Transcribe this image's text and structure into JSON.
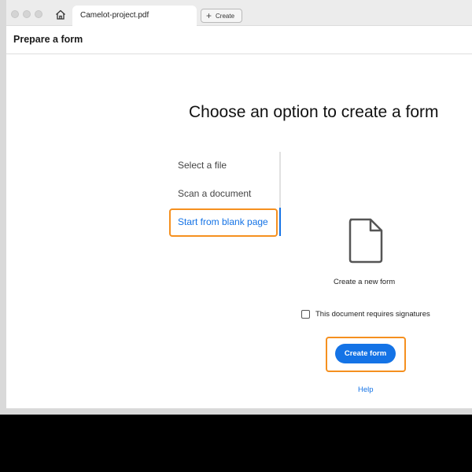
{
  "window": {
    "tab_title": "Camelot-project.pdf",
    "create_tab_label": "Create"
  },
  "toolbar": {
    "title": "Prepare a form"
  },
  "main": {
    "heading": "Choose an option to create a form",
    "options": [
      {
        "label": "Select a file",
        "selected": false
      },
      {
        "label": "Scan a document",
        "selected": false
      },
      {
        "label": "Start from blank page",
        "selected": true
      }
    ],
    "panel": {
      "icon": "document-icon",
      "label": "Create a new form",
      "checkbox_label": "This document requires signatures",
      "checkbox_checked": false,
      "create_button_label": "Create form",
      "help_label": "Help"
    }
  },
  "colors": {
    "accent": "#1473e6",
    "highlight": "#f5901f"
  }
}
